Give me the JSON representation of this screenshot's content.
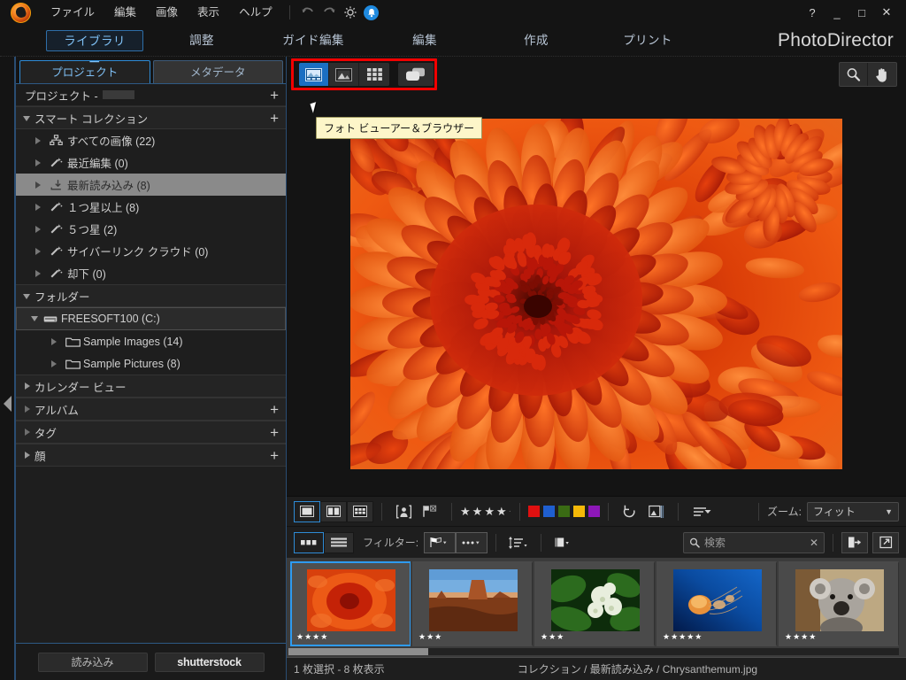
{
  "app": {
    "brand": "PhotoDirector",
    "menu": [
      "ファイル",
      "編集",
      "画像",
      "表示",
      "ヘルプ"
    ],
    "icons": {
      "undo": "undo-icon",
      "redo": "redo-icon",
      "settings": "gear-icon",
      "notify": "bell-icon"
    },
    "window": {
      "help": "?",
      "minimize": "_",
      "maximize": "□",
      "close": "✕"
    }
  },
  "tabs": [
    {
      "label": "ライブラリー",
      "active": true
    },
    {
      "label": "調整",
      "active": false
    },
    {
      "label": "ガイド編集",
      "active": false
    },
    {
      "label": "編集",
      "active": false
    },
    {
      "label": "作成",
      "active": false
    },
    {
      "label": "プリント",
      "active": false
    }
  ],
  "sidebar": {
    "tabs": [
      {
        "label": "プロジェクト",
        "active": true
      },
      {
        "label": "メタデータ",
        "active": false
      }
    ],
    "project_header": {
      "label": "プロジェクト -",
      "plus": "+"
    },
    "groups": [
      {
        "label": "スマート コレクション",
        "expanded": true,
        "plus": "+",
        "items": [
          {
            "label": "すべての画像 (22)",
            "icon": "collection-icon",
            "selected": false
          },
          {
            "label": "最近編集 (0)",
            "icon": "magic-wand-icon",
            "selected": false
          },
          {
            "label": "最新読み込み (8)",
            "icon": "import-icon",
            "selected": true
          },
          {
            "label": "１つ星以上 (8)",
            "icon": "magic-wand-icon",
            "selected": false
          },
          {
            "label": "５つ星 (2)",
            "icon": "magic-wand-icon",
            "selected": false
          },
          {
            "label": "サイバーリンク クラウド (0)",
            "icon": "magic-wand-icon",
            "selected": false
          },
          {
            "label": "却下 (0)",
            "icon": "magic-wand-icon",
            "selected": false
          }
        ]
      },
      {
        "label": "フォルダー",
        "expanded": true,
        "plus": "",
        "items": [
          {
            "label": "FREESOFT100 (C:)",
            "icon": "drive-icon",
            "selected": false,
            "level": 1,
            "expanded": true
          },
          {
            "label": "Sample Images (14)",
            "icon": "folder-icon",
            "selected": false,
            "level": 2
          },
          {
            "label": "Sample Pictures (8)",
            "icon": "folder-icon",
            "selected": false,
            "level": 2
          }
        ]
      },
      {
        "label": "カレンダー ビュー",
        "expanded": false,
        "plus": "",
        "items": []
      },
      {
        "label": "アルバム",
        "expanded": false,
        "plus": "+",
        "items": []
      },
      {
        "label": "タグ",
        "expanded": false,
        "plus": "+",
        "items": []
      },
      {
        "label": "顔",
        "expanded": false,
        "plus": "+",
        "items": []
      }
    ],
    "bottom": {
      "import_label": "読み込み",
      "shutterstock_label": "shutterstock"
    }
  },
  "viewbar": {
    "modes": [
      {
        "name": "photo-viewer-browser",
        "active": true
      },
      {
        "name": "viewer-only",
        "active": false
      },
      {
        "name": "grid-view",
        "active": false
      },
      {
        "name": "slideshow-view",
        "active": false
      }
    ],
    "tooltip": "フォト ビューアー＆ブラウザー",
    "right_tools": [
      {
        "name": "zoom-tool",
        "icon": "magnifier-icon"
      },
      {
        "name": "hand-tool",
        "icon": "hand-icon"
      }
    ],
    "highlight_color": "#f10000"
  },
  "photo": {
    "filename": "Chrysanthemum.jpg",
    "alt": "orange chrysanthemum close-up"
  },
  "toolbar": {
    "layout_modes": [
      {
        "name": "single-view",
        "active": true
      },
      {
        "name": "compare-view",
        "active": false
      },
      {
        "name": "multi-view",
        "active": false
      }
    ],
    "face_tool": "face-tag-icon",
    "flag_tool": "flag-reject-icon",
    "rating": {
      "stars": 4,
      "max": 5,
      "symbol": "★"
    },
    "colors": [
      "#e01010",
      "#1f5fd0",
      "#3a6b14",
      "#f5b908",
      "#8d17b8"
    ],
    "rotate_tool": "rotate-icon",
    "compare_tool": "before-after-icon",
    "sort_tool": "sort-icon",
    "zoom": {
      "label": "ズーム:",
      "value": "フィット",
      "caret": "▼"
    }
  },
  "filterbar": {
    "view_modes": [
      {
        "name": "thumbnail-view",
        "active": true
      },
      {
        "name": "list-view",
        "active": false
      }
    ],
    "filter_label": "フィルター:",
    "filter_buttons": [
      "flag-filter",
      "more-filter"
    ],
    "sort_order_button": "sort-order",
    "stack_button": "stack-view",
    "search": {
      "placeholder": "検索",
      "value": "",
      "clear": "✕",
      "icon": "search-icon"
    },
    "export_button": "export-icon",
    "open_external_button": "open-external-icon"
  },
  "filmstrip": {
    "items": [
      {
        "name": "Chrysanthemum.jpg",
        "stars": 4,
        "selected": true,
        "kind": "flower-orange"
      },
      {
        "name": "Desert.jpg",
        "stars": 3,
        "selected": false,
        "kind": "desert"
      },
      {
        "name": "Hydrangeas.jpg",
        "stars": 3,
        "selected": false,
        "kind": "hydrangea"
      },
      {
        "name": "Jellyfish.jpg",
        "stars": 5,
        "selected": false,
        "kind": "jellyfish"
      },
      {
        "name": "Koala.jpg",
        "stars": 4,
        "selected": false,
        "kind": "koala"
      }
    ],
    "star_symbol": "★"
  },
  "status": {
    "selection": "1 枚選択 - 8 枚表示",
    "path": "コレクション / 最新読み込み / Chrysanthemum.jpg"
  }
}
